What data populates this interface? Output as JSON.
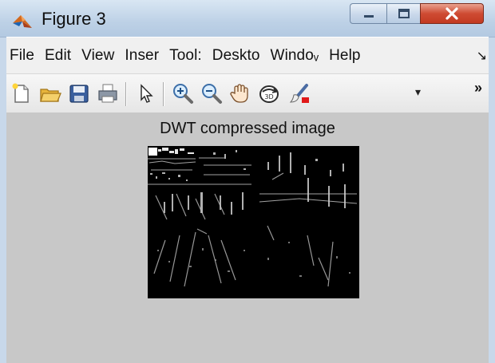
{
  "window": {
    "title": "Figure 3",
    "app_icon": "matlab-logo-icon",
    "caption_buttons": [
      "minimize-icon",
      "maximize-icon",
      "close-icon"
    ]
  },
  "menu": {
    "items": [
      "File",
      "Edit",
      "View",
      "Inser",
      "Tool:",
      "Deskto",
      "Windoᵥ",
      "Help"
    ],
    "overflow_icon": "menu-overflow-icon"
  },
  "toolbar": {
    "buttons": [
      "new-figure-icon",
      "open-file-icon",
      "save-icon",
      "print-icon",
      "pointer-icon",
      "zoom-in-icon",
      "zoom-out-icon",
      "pan-hand-icon",
      "rotate-3d-icon",
      "brush-icon"
    ],
    "dropdown_glyph": "▾",
    "overflow_glyph": "»"
  },
  "figure": {
    "axes_title": "DWT compressed image",
    "background_color": "#c8c8c8",
    "image_background": "#000000"
  }
}
